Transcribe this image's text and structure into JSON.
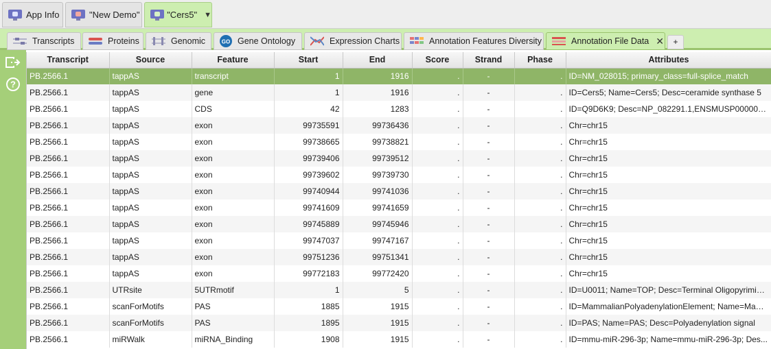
{
  "project_tabs": [
    {
      "label": "App Info",
      "icon": "monitor-icon",
      "active": false
    },
    {
      "label": "\"New Demo\"",
      "icon": "monitor-icon",
      "active": false
    },
    {
      "label": "\"Cers5\"",
      "icon": "monitor-icon",
      "active": true
    }
  ],
  "view_tabs": [
    {
      "label": "Transcripts",
      "icon": "transcripts-icon"
    },
    {
      "label": "Proteins",
      "icon": "proteins-icon"
    },
    {
      "label": "Genomic",
      "icon": "genomic-icon"
    },
    {
      "label": "Gene Ontology",
      "icon": "go-icon",
      "badge": "GO"
    },
    {
      "label": "Expression Charts",
      "icon": "expression-chart-icon"
    },
    {
      "label": "Annotation Features Diversity",
      "icon": "diversity-icon"
    },
    {
      "label": "Annotation File Data",
      "icon": "annotation-file-icon",
      "active": true,
      "close": "✕"
    }
  ],
  "add_tab_label": "+",
  "rail": {
    "export_icon": "export-icon",
    "help_icon": "help-icon",
    "help_glyph": "?"
  },
  "table": {
    "columns": [
      "Transcript",
      "Source",
      "Feature",
      "Start",
      "End",
      "Score",
      "Strand",
      "Phase",
      "Attributes"
    ],
    "rows": [
      {
        "transcript": "PB.2566.1",
        "source": "tappAS",
        "feature": "transcript",
        "start": "1",
        "end": "1916",
        "score": ".",
        "strand": "-",
        "phase": ".",
        "attributes": "ID=NM_028015; primary_class=full-splice_match",
        "selected": true
      },
      {
        "transcript": "PB.2566.1",
        "source": "tappAS",
        "feature": "gene",
        "start": "1",
        "end": "1916",
        "score": ".",
        "strand": "-",
        "phase": ".",
        "attributes": "ID=Cers5; Name=Cers5; Desc=ceramide synthase 5"
      },
      {
        "transcript": "PB.2566.1",
        "source": "tappAS",
        "feature": "CDS",
        "start": "42",
        "end": "1283",
        "score": ".",
        "strand": "-",
        "phase": ".",
        "attributes": "ID=Q9D6K9; Desc=NP_082291.1,ENSMUSP00000023..."
      },
      {
        "transcript": "PB.2566.1",
        "source": "tappAS",
        "feature": "exon",
        "start": "99735591",
        "end": "99736436",
        "score": ".",
        "strand": "-",
        "phase": ".",
        "attributes": "Chr=chr15"
      },
      {
        "transcript": "PB.2566.1",
        "source": "tappAS",
        "feature": "exon",
        "start": "99738665",
        "end": "99738821",
        "score": ".",
        "strand": "-",
        "phase": ".",
        "attributes": "Chr=chr15"
      },
      {
        "transcript": "PB.2566.1",
        "source": "tappAS",
        "feature": "exon",
        "start": "99739406",
        "end": "99739512",
        "score": ".",
        "strand": "-",
        "phase": ".",
        "attributes": "Chr=chr15"
      },
      {
        "transcript": "PB.2566.1",
        "source": "tappAS",
        "feature": "exon",
        "start": "99739602",
        "end": "99739730",
        "score": ".",
        "strand": "-",
        "phase": ".",
        "attributes": "Chr=chr15"
      },
      {
        "transcript": "PB.2566.1",
        "source": "tappAS",
        "feature": "exon",
        "start": "99740944",
        "end": "99741036",
        "score": ".",
        "strand": "-",
        "phase": ".",
        "attributes": "Chr=chr15"
      },
      {
        "transcript": "PB.2566.1",
        "source": "tappAS",
        "feature": "exon",
        "start": "99741609",
        "end": "99741659",
        "score": ".",
        "strand": "-",
        "phase": ".",
        "attributes": "Chr=chr15"
      },
      {
        "transcript": "PB.2566.1",
        "source": "tappAS",
        "feature": "exon",
        "start": "99745889",
        "end": "99745946",
        "score": ".",
        "strand": "-",
        "phase": ".",
        "attributes": "Chr=chr15"
      },
      {
        "transcript": "PB.2566.1",
        "source": "tappAS",
        "feature": "exon",
        "start": "99747037",
        "end": "99747167",
        "score": ".",
        "strand": "-",
        "phase": ".",
        "attributes": "Chr=chr15"
      },
      {
        "transcript": "PB.2566.1",
        "source": "tappAS",
        "feature": "exon",
        "start": "99751236",
        "end": "99751341",
        "score": ".",
        "strand": "-",
        "phase": ".",
        "attributes": "Chr=chr15"
      },
      {
        "transcript": "PB.2566.1",
        "source": "tappAS",
        "feature": "exon",
        "start": "99772183",
        "end": "99772420",
        "score": ".",
        "strand": "-",
        "phase": ".",
        "attributes": "Chr=chr15"
      },
      {
        "transcript": "PB.2566.1",
        "source": "UTRsite",
        "feature": "5UTRmotif",
        "start": "1",
        "end": "5",
        "score": ".",
        "strand": "-",
        "phase": ".",
        "attributes": "ID=U0011; Name=TOP; Desc=Terminal Oligopyrimidi..."
      },
      {
        "transcript": "PB.2566.1",
        "source": "scanForMotifs",
        "feature": "PAS",
        "start": "1885",
        "end": "1915",
        "score": ".",
        "strand": "-",
        "phase": ".",
        "attributes": "ID=MammalianPolyadenylationElement; Name=Mam..."
      },
      {
        "transcript": "PB.2566.1",
        "source": "scanForMotifs",
        "feature": "PAS",
        "start": "1895",
        "end": "1915",
        "score": ".",
        "strand": "-",
        "phase": ".",
        "attributes": "ID=PAS; Name=PAS; Desc=Polyadenylation signal"
      },
      {
        "transcript": "PB.2566.1",
        "source": "miRWalk",
        "feature": "miRNA_Binding",
        "start": "1908",
        "end": "1915",
        "score": ".",
        "strand": "-",
        "phase": ".",
        "attributes": "ID=mmu-miR-296-3p; Name=mmu-miR-296-3p; Des..."
      }
    ]
  },
  "colors": {
    "accent_green": "#9ac36d",
    "selected_row": "#8fb567",
    "tab_active": "#cdeeb0"
  }
}
